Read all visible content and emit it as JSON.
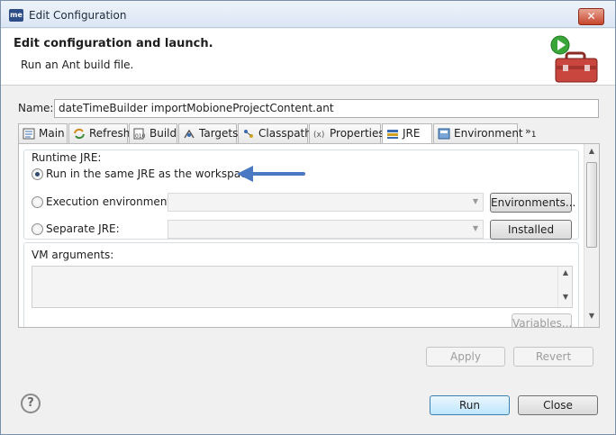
{
  "window": {
    "title": "Edit Configuration",
    "app_icon_text": "me",
    "close_glyph": "✕"
  },
  "banner": {
    "title": "Edit configuration and launch.",
    "subtitle": "Run an Ant build file.",
    "icon": "run-toolbox-icon"
  },
  "name": {
    "label": "Name:",
    "value": "dateTimeBuilder importMobioneProjectContent.ant"
  },
  "tabs": [
    {
      "label": "Main",
      "icon": "main-icon"
    },
    {
      "label": "Refresh",
      "icon": "refresh-icon"
    },
    {
      "label": "Build",
      "icon": "build-icon"
    },
    {
      "label": "Targets",
      "icon": "targets-icon"
    },
    {
      "label": "Classpath",
      "icon": "classpath-icon"
    },
    {
      "label": "Properties",
      "icon": "properties-icon"
    },
    {
      "label": "JRE",
      "icon": "jre-icon",
      "active": true
    },
    {
      "label": "Environment",
      "icon": "environment-icon"
    }
  ],
  "tab_overflow": {
    "glyph": "»",
    "count": "1"
  },
  "runtime_jre": {
    "title": "Runtime JRE:",
    "options": [
      {
        "label": "Run in the same JRE as the workspace",
        "checked": true
      },
      {
        "label": "Execution environment:",
        "checked": false
      },
      {
        "label": "Separate JRE:",
        "checked": false
      }
    ],
    "environments_button": "Environments...",
    "installed_jres_button": "Installed JREs...",
    "arrow_color": "#4a78c2"
  },
  "vm_arguments": {
    "title": "VM arguments:",
    "variables_button": "Variables..."
  },
  "actions": {
    "apply": "Apply",
    "revert": "Revert",
    "run": "Run",
    "close": "Close"
  },
  "help": {
    "glyph": "?"
  }
}
